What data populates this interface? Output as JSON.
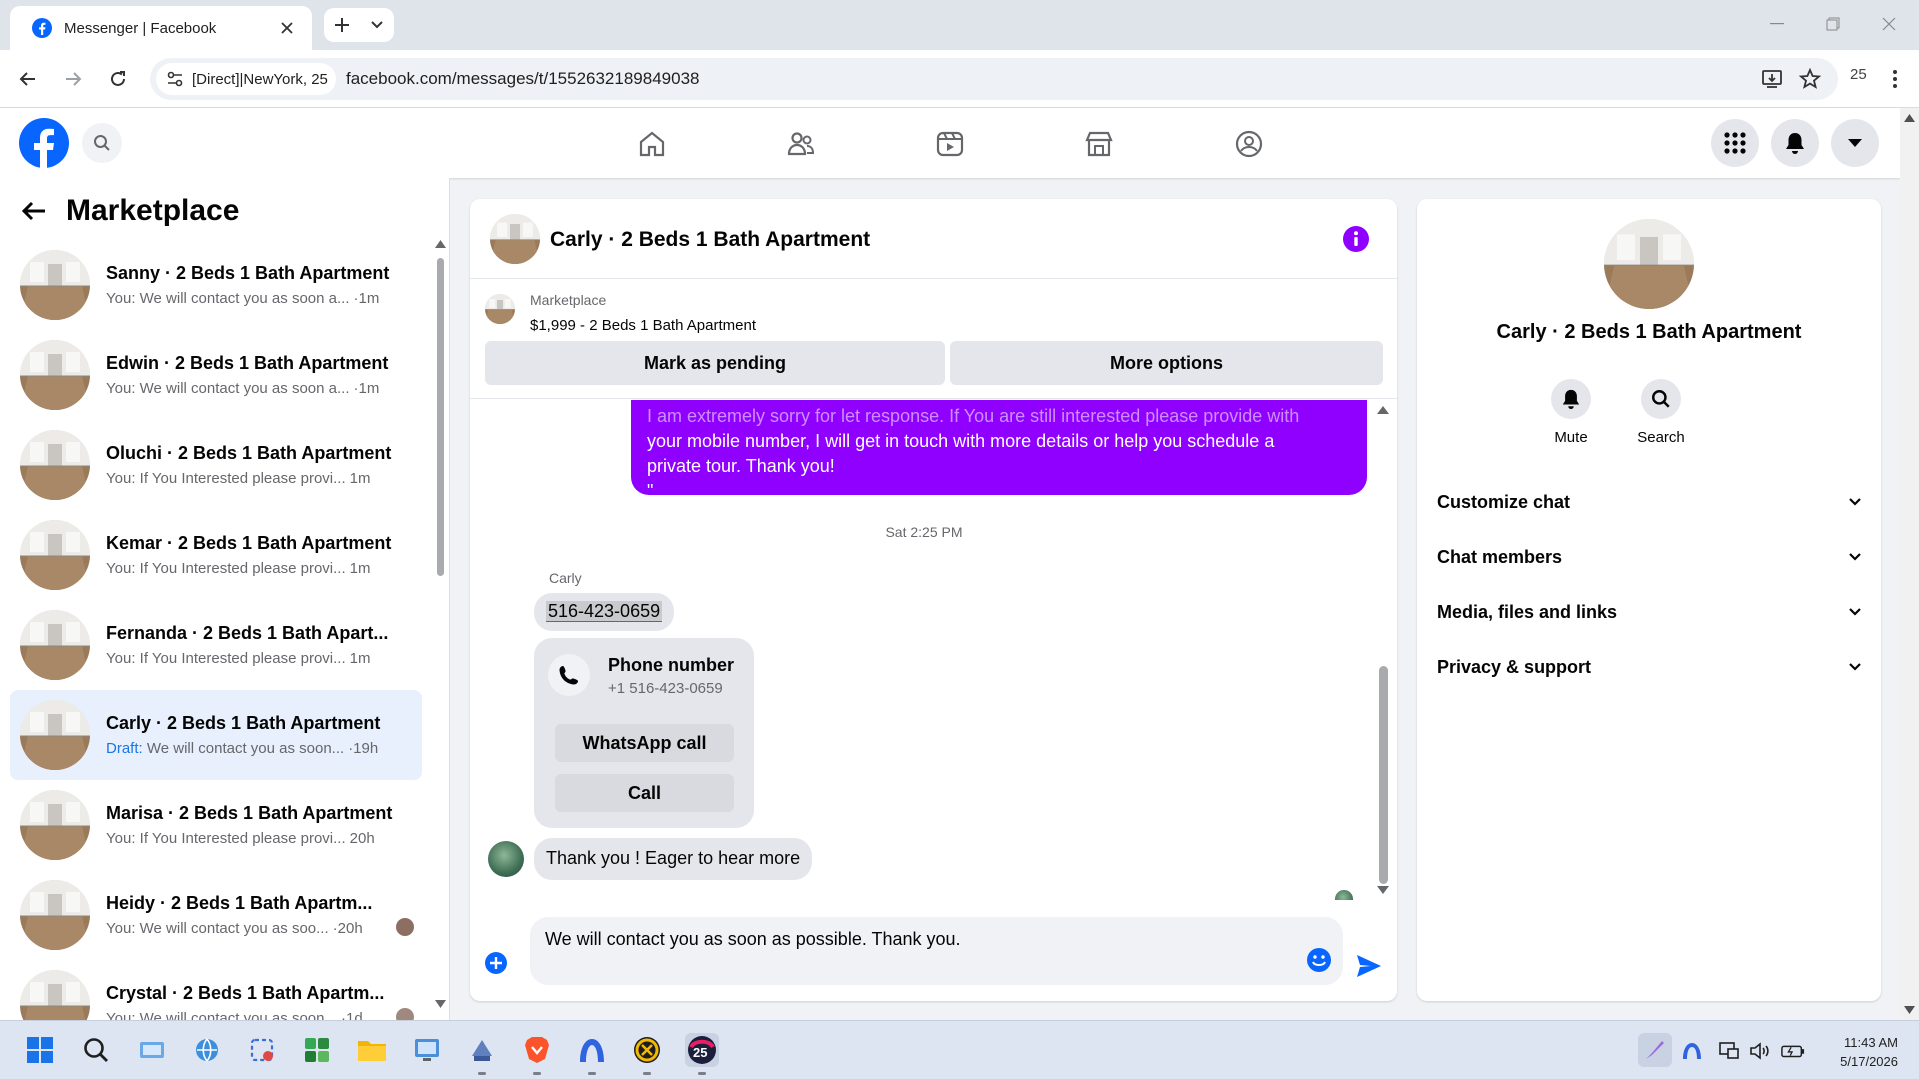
{
  "browser": {
    "tab_title": "Messenger | Facebook",
    "site_chip": "[Direct]|NewYork, 25",
    "url": "facebook.com/messages/t/1552632189849038",
    "profile_badge": "25"
  },
  "sidebar": {
    "title": "Marketplace",
    "conversations": [
      {
        "name": "Sanny · 2 Beds 1 Bath Apartment",
        "prefix": "You:",
        "preview": "We will contact you as soon a...",
        "time": "·1m"
      },
      {
        "name": "Edwin · 2 Beds 1 Bath Apartment",
        "prefix": "You:",
        "preview": "We will contact you as soon a...",
        "time": "·1m"
      },
      {
        "name": "Oluchi · 2 Beds 1 Bath Apartment",
        "prefix": "You:",
        "preview": "If You Interested please provi...",
        "time": "1m"
      },
      {
        "name": "Kemar · 2 Beds 1 Bath Apartment",
        "prefix": "You:",
        "preview": "If You Interested please provi...",
        "time": "1m"
      },
      {
        "name": "Fernanda · 2 Beds 1 Bath Apart...",
        "prefix": "You:",
        "preview": "If You Interested please provi...",
        "time": "1m"
      },
      {
        "name": "Carly · 2 Beds 1 Bath Apartment",
        "prefix": "Draft:",
        "preview": "We will contact you as soon...",
        "time": "·19h"
      },
      {
        "name": "Marisa · 2 Beds 1 Bath Apartment",
        "prefix": "You:",
        "preview": "If You Interested please provi...",
        "time": "20h"
      },
      {
        "name": "Heidy · 2 Beds 1 Bath Apartm...",
        "prefix": "You:",
        "preview": "We will contact you as soo...",
        "time": "·20h"
      },
      {
        "name": "Crystal · 2 Beds 1 Bath Apartm...",
        "prefix": "You:",
        "preview": "We will contact you as soon...",
        "time": "·1d"
      }
    ]
  },
  "chat": {
    "title": "Carly · 2 Beds 1 Bath Apartment",
    "marketplace_label": "Marketplace",
    "listing": "$1,999 - 2 Beds 1 Bath Apartment",
    "mark_pending": "Mark as pending",
    "more_options": "More options",
    "outgoing_line1": "I am extremely sorry for let response. If You are still interested please provide with",
    "outgoing_line2": "your mobile number, I will get in touch with more details or help you schedule a",
    "outgoing_line3": "private tour. Thank you!",
    "outgoing_line4": "\"",
    "timestamp": "Sat 2:25 PM",
    "sender": "Carly",
    "phone_message": "516-423-0659",
    "phone_card": {
      "title": "Phone number",
      "number": "+1 516-423-0659",
      "whatsapp": "WhatsApp call",
      "call": "Call"
    },
    "last_message": "Thank you !  Eager to hear more",
    "composer_value": "We will contact you as soon as possible. Thank you."
  },
  "details": {
    "name": "Carly · 2 Beds 1 Bath Apartment",
    "mute": "Mute",
    "search": "Search",
    "sections": [
      "Customize chat",
      "Chat members",
      "Media, files and links",
      "Privacy & support"
    ]
  },
  "taskbar": {
    "time": "11:43 AM",
    "date": "5/17/2026",
    "badge": "25"
  },
  "colors": {
    "facebook_blue": "#0866ff",
    "outgoing_bubble": "#8f00ff",
    "info_purple": "#8f00ff",
    "active_row": "#e7f0fc"
  }
}
